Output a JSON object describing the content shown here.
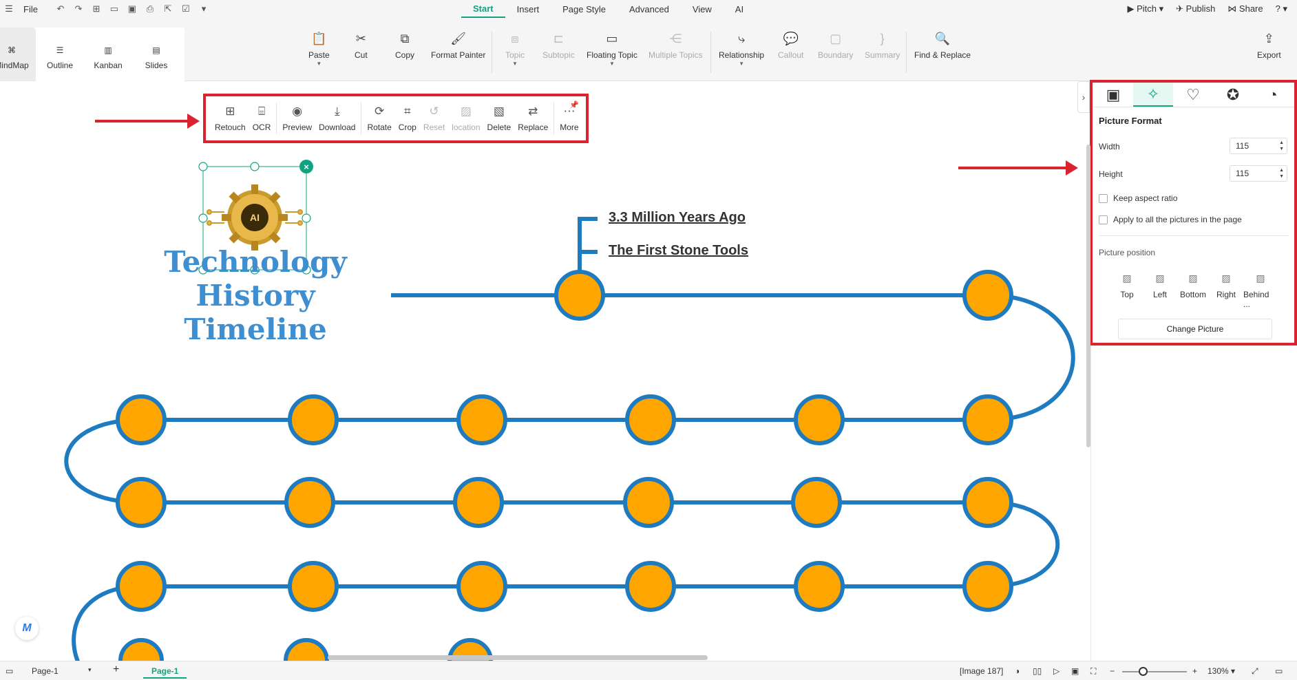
{
  "menubar": {
    "file_label": "File",
    "tabs": [
      "Start",
      "Insert",
      "Page Style",
      "Advanced",
      "View",
      "AI"
    ],
    "active_tab": "Start",
    "right": {
      "pitch": "Pitch",
      "publish": "Publish",
      "share": "Share"
    }
  },
  "views": [
    "MindMap",
    "Outline",
    "Kanban",
    "Slides"
  ],
  "ribbon": {
    "paste": "Paste",
    "cut": "Cut",
    "copy": "Copy",
    "format_painter": "Format Painter",
    "topic": "Topic",
    "subtopic": "Subtopic",
    "floating_topic": "Floating Topic",
    "multiple_topics": "Multiple Topics",
    "relationship": "Relationship",
    "callout": "Callout",
    "boundary": "Boundary",
    "summary": "Summary",
    "find_replace": "Find & Replace",
    "export": "Export"
  },
  "picture_toolbar": {
    "retouch": "Retouch",
    "ocr": "OCR",
    "preview": "Preview",
    "download": "Download",
    "rotate": "Rotate",
    "crop": "Crop",
    "reset": "Reset",
    "location": "location",
    "delete": "Delete",
    "replace": "Replace",
    "more": "More"
  },
  "canvas": {
    "title_lines": [
      "Technology",
      "History",
      "Timeline"
    ],
    "logo_text": "AI",
    "labels": [
      "3.3 Million Years Ago",
      "The First Stone Tools"
    ]
  },
  "panel": {
    "title": "Picture Format",
    "width_label": "Width",
    "width_value": "115",
    "height_label": "Height",
    "height_value": "115",
    "keep_aspect": "Keep aspect ratio",
    "apply_all": "Apply to all the pictures in the page",
    "position_label": "Picture position",
    "positions": [
      "Top",
      "Left",
      "Bottom",
      "Right",
      "Behind ..."
    ],
    "change_button": "Change Picture"
  },
  "statusbar": {
    "page_select": "Page-1",
    "page_tab": "Page-1",
    "image_info": "[Image 187]",
    "zoom": "130%"
  },
  "colors": {
    "accent": "#10a37f",
    "highlight": "#d9242f",
    "path": "#1e7bbf",
    "node": "#ffa500",
    "title_text": "#3f8fd0"
  }
}
